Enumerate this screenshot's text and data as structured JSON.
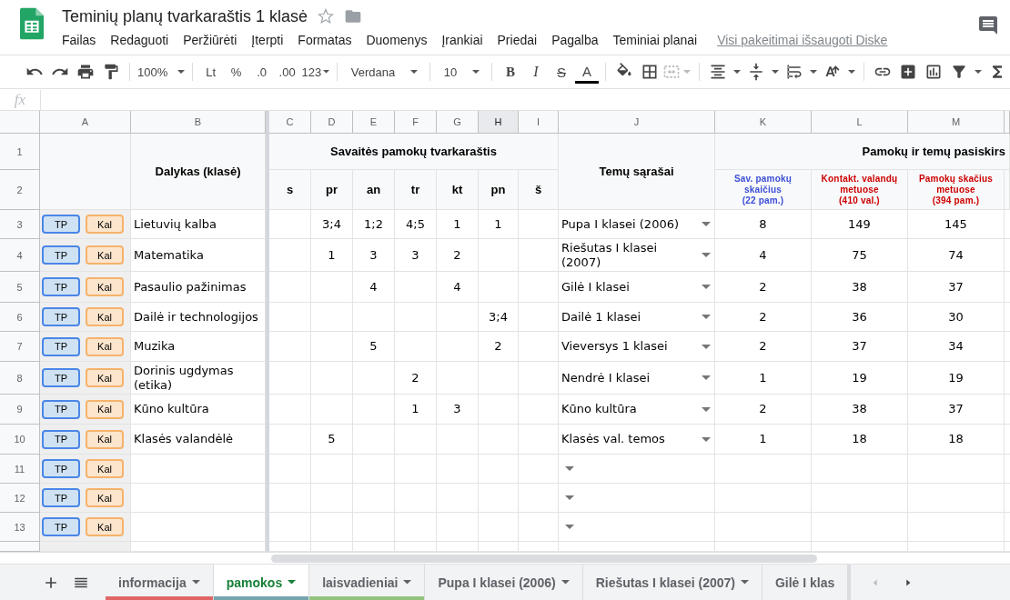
{
  "document": {
    "title": "Teminių planų tvarkaraštis 1 klasė",
    "menu": [
      "Failas",
      "Redaguoti",
      "Peržiūrėti",
      "Įterpti",
      "Formatas",
      "Duomenys",
      "Įrankiai",
      "Priedai",
      "Pagalba",
      "Teminiai planai"
    ],
    "save_status": "Visi pakeitimai išsaugoti Diske"
  },
  "toolbar": {
    "zoom": "100%",
    "currency": "Lt",
    "percent": "%",
    "decrease_decimals": ".0",
    "increase_decimals": ".00",
    "number_format": "123",
    "font": "Verdana",
    "font_size": "10",
    "bold": "B",
    "italic": "I",
    "strikethrough": "S",
    "text_color": "A"
  },
  "formula_bar": {
    "label": "fx"
  },
  "columns": [
    {
      "label": "A",
      "selected": false
    },
    {
      "label": "B",
      "selected": false
    },
    {
      "label": "C",
      "selected": false
    },
    {
      "label": "D",
      "selected": false
    },
    {
      "label": "E",
      "selected": false
    },
    {
      "label": "F",
      "selected": false
    },
    {
      "label": "G",
      "selected": false
    },
    {
      "label": "H",
      "selected": true
    },
    {
      "label": "I",
      "selected": false
    },
    {
      "label": "J",
      "selected": false
    },
    {
      "label": "K",
      "selected": false
    },
    {
      "label": "L",
      "selected": false
    },
    {
      "label": "M",
      "selected": false
    }
  ],
  "header": {
    "row_numbers": [
      "1",
      "2"
    ],
    "subject": "Dalykas (klasė)",
    "schedule_title": "Savaitės pamokų tvarkaraštis",
    "days": [
      "s",
      "pr",
      "an",
      "tr",
      "kt",
      "pn",
      "š"
    ],
    "topics": "Temų sąrašai",
    "distribution_title": "Pamokų ir temų pasiskirs",
    "subheaders": [
      {
        "text": "Sav. pamokų\nskaičius\n(22 pam.)",
        "color": "#3c4fd6"
      },
      {
        "text": "Kontakt. valandų\nmetuose\n(410 val.)",
        "color": "#cc0000"
      },
      {
        "text": "Pamokų skačius\nmetuose\n(394 pam.)",
        "color": "#cc0000"
      }
    ]
  },
  "rows": [
    {
      "number": "3",
      "buttons": [
        "TP",
        "Kal"
      ],
      "subject": "Lietuvių kalba",
      "schedule": {
        "D": "3;4",
        "E": "1;2",
        "F": "4;5",
        "G": "1",
        "H": "1"
      },
      "topics": "Pupa I klasei (2006)",
      "weekly": "8",
      "contact_hours": "149",
      "lessons": "145"
    },
    {
      "number": "4",
      "buttons": [
        "TP",
        "Kal"
      ],
      "subject": "Matematika",
      "schedule": {
        "D": "1",
        "E": "3",
        "F": "3",
        "G": "2"
      },
      "topics": "Riešutas I klasei (2007)",
      "weekly": "4",
      "contact_hours": "75",
      "lessons": "74"
    },
    {
      "number": "5",
      "buttons": [
        "TP",
        "Kal"
      ],
      "subject": "Pasaulio pažinimas",
      "schedule": {
        "E": "4",
        "G": "4"
      },
      "topics": "Gilė I klasei",
      "weekly": "2",
      "contact_hours": "38",
      "lessons": "37"
    },
    {
      "number": "6",
      "buttons": [
        "TP",
        "Kal"
      ],
      "subject": "Dailė ir technologijos",
      "schedule": {
        "H": "3;4"
      },
      "topics": "Dailė 1 klasei",
      "weekly": "2",
      "contact_hours": "36",
      "lessons": "30"
    },
    {
      "number": "7",
      "buttons": [
        "TP",
        "Kal"
      ],
      "subject": "Muzika",
      "schedule": {
        "E": "5",
        "H": "2"
      },
      "topics": "Vieversys 1 klasei",
      "weekly": "2",
      "contact_hours": "37",
      "lessons": "34"
    },
    {
      "number": "8",
      "buttons": [
        "TP",
        "Kal"
      ],
      "subject": "Dorinis ugdymas (etika)",
      "schedule": {
        "F": "2"
      },
      "topics": "Nendrė I klasei",
      "weekly": "1",
      "contact_hours": "19",
      "lessons": "19"
    },
    {
      "number": "9",
      "buttons": [
        "TP",
        "Kal"
      ],
      "subject": "Kūno kultūra",
      "schedule": {
        "F": "1",
        "G": "3"
      },
      "topics": "Kūno kultūra",
      "weekly": "2",
      "contact_hours": "38",
      "lessons": "37"
    },
    {
      "number": "10",
      "buttons": [
        "TP",
        "Kal"
      ],
      "subject": "Klasės valandėlė",
      "schedule": {
        "D": "5"
      },
      "topics": "Klasės val. temos",
      "weekly": "1",
      "contact_hours": "18",
      "lessons": "18"
    },
    {
      "number": "11",
      "buttons": [
        "TP",
        "Kal"
      ]
    },
    {
      "number": "12",
      "buttons": [
        "TP",
        "Kal"
      ]
    },
    {
      "number": "13",
      "buttons": [
        "TP",
        "Kal"
      ]
    }
  ],
  "sheet_tabs": [
    {
      "label": "informacija",
      "selected": false,
      "color": "#e06666"
    },
    {
      "label": "pamokos",
      "selected": true,
      "color": "#76a5af"
    },
    {
      "label": "laisvadieniai",
      "selected": false,
      "color": "#93c47d"
    },
    {
      "label": "Pupa I klasei (2006)",
      "selected": false
    },
    {
      "label": "Riešutas I klasei (2007)",
      "selected": false
    },
    {
      "label": "Gilė I klas",
      "selected": false
    }
  ]
}
